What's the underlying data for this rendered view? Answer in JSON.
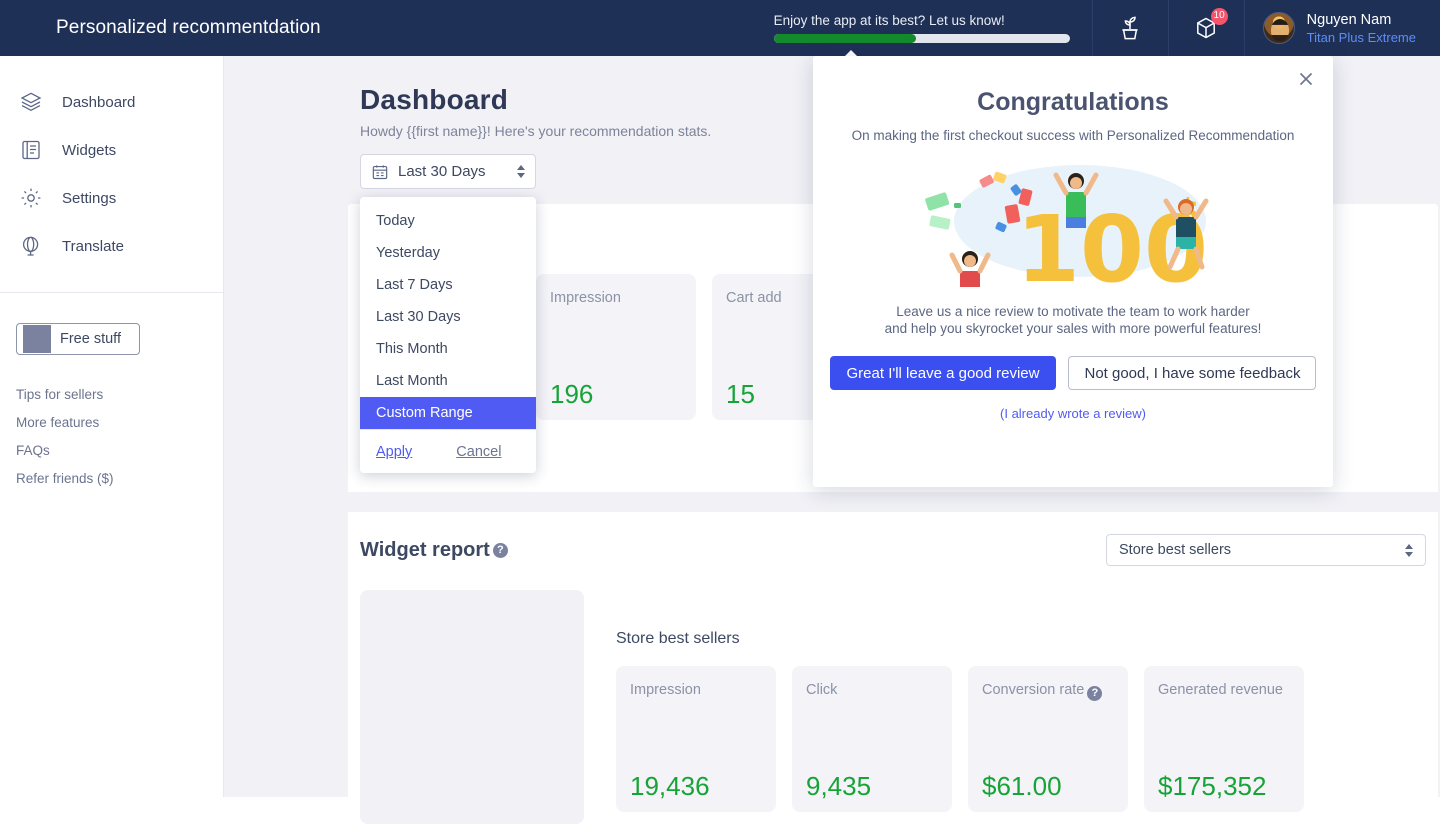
{
  "topbar": {
    "brand": "Personalized recommentdation",
    "feedback_text": "Enjoy the app at its best? Let us know!",
    "progress_percent": 48,
    "plant_icon": "plant-icon",
    "box_icon": "box-icon",
    "box_badge": "10",
    "user_name": "Nguyen Nam",
    "user_plan": "Titan Plus Extreme"
  },
  "sidebar": {
    "items": [
      {
        "label": "Dashboard",
        "icon": "layers-icon"
      },
      {
        "label": "Widgets",
        "icon": "widgets-icon"
      },
      {
        "label": "Settings",
        "icon": "gear-icon"
      },
      {
        "label": "Translate",
        "icon": "globe-icon"
      }
    ],
    "free_stuff_label": "Free stuff",
    "links": [
      "Tips for sellers",
      "More features",
      "FAQs",
      "Refer friends ($)"
    ]
  },
  "page": {
    "title": "Dashboard",
    "subtitle": "Howdy {{first name}}! Here's your recommendation stats."
  },
  "date_select": {
    "value": "Last 30 Days",
    "icon": "calendar-icon",
    "options": [
      "Today",
      "Yesterday",
      "Last 7 Days",
      "Last 30 Days",
      "This Month",
      "Last Month",
      "Custom Range"
    ],
    "selected_option": "Custom Range",
    "apply_label": "Apply",
    "cancel_label": "Cancel"
  },
  "overview_stats": [
    {
      "label": "",
      "value": ""
    },
    {
      "label": "Impression",
      "value": "196"
    },
    {
      "label": "Cart add",
      "value": "15"
    }
  ],
  "widget_report": {
    "title": "Widget report",
    "help_icon": "help-icon",
    "select_value": "Store best sellers",
    "section_label": "Store best sellers",
    "stats": [
      {
        "label": "Impression",
        "value": "19,436",
        "help": false
      },
      {
        "label": "Click",
        "value": "9,435",
        "help": false
      },
      {
        "label": "Conversion rate",
        "value": "$61.00",
        "help": true
      },
      {
        "label": "Generated revenue",
        "value": "$175,352",
        "help": false
      }
    ]
  },
  "modal": {
    "close_icon": "close-icon",
    "title": "Congratulations",
    "subtitle": "On making the first checkout success with Personalized Recommendation",
    "hero_icon": "celebration-100-dollars-illustration",
    "note_line1": "Leave us a nice review to motivate the team to work harder",
    "note_line2": "and help you skyrocket your sales with more powerful features!",
    "primary_button": "Great I'll leave a good review",
    "secondary_button": "Not good, I have some feedback",
    "link": "(I already wrote a review)"
  },
  "colors": {
    "topbar_bg": "#1f3057",
    "accent_blue": "#4f5bf2",
    "primary_button": "#3b4ef0",
    "stat_green": "#17a436",
    "progress_green": "#138a2c",
    "badge_red": "#f4556c",
    "page_bg": "#f1f1f6",
    "card_bg": "#f3f3f8"
  }
}
